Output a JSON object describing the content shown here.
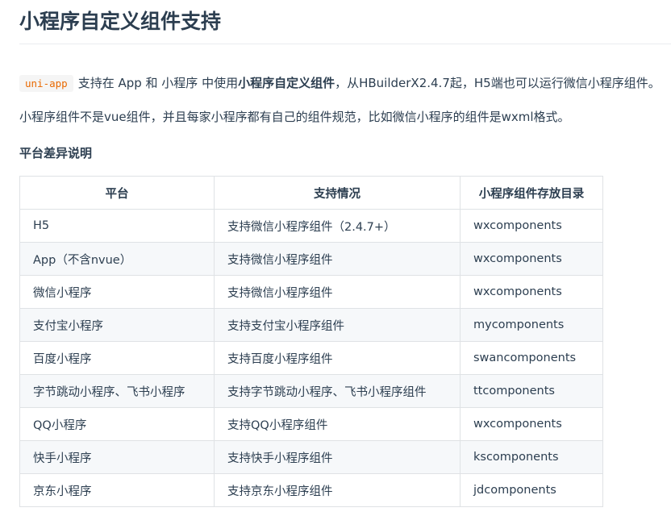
{
  "title": "小程序自定义组件支持",
  "intro": {
    "code": "uni-app",
    "text1": "支持在 App 和 小程序 中使用",
    "bold": "小程序自定义组件",
    "text2": "，从HBuilderX2.4.7起，H5端也可以运行微信小程序组件。"
  },
  "paragraph2": "小程序组件不是vue组件，并且每家小程序都有自己的组件规范，比如微信小程序的组件是wxml格式。",
  "section_heading": "平台差异说明",
  "table": {
    "headers": [
      "平台",
      "支持情况",
      "小程序组件存放目录"
    ],
    "rows": [
      [
        "H5",
        "支持微信小程序组件（2.4.7+）",
        "wxcomponents"
      ],
      [
        "App（不含nvue）",
        "支持微信小程序组件",
        "wxcomponents"
      ],
      [
        "微信小程序",
        "支持微信小程序组件",
        "wxcomponents"
      ],
      [
        "支付宝小程序",
        "支持支付宝小程序组件",
        "mycomponents"
      ],
      [
        "百度小程序",
        "支持百度小程序组件",
        "swancomponents"
      ],
      [
        "字节跳动小程序、飞书小程序",
        "支持字节跳动小程序、飞书小程序组件",
        "ttcomponents"
      ],
      [
        "QQ小程序",
        "支持QQ小程序组件",
        "wxcomponents"
      ],
      [
        "快手小程序",
        "支持快手小程序组件",
        "kscomponents"
      ],
      [
        "京东小程序",
        "支持京东小程序组件",
        "jdcomponents"
      ]
    ]
  }
}
